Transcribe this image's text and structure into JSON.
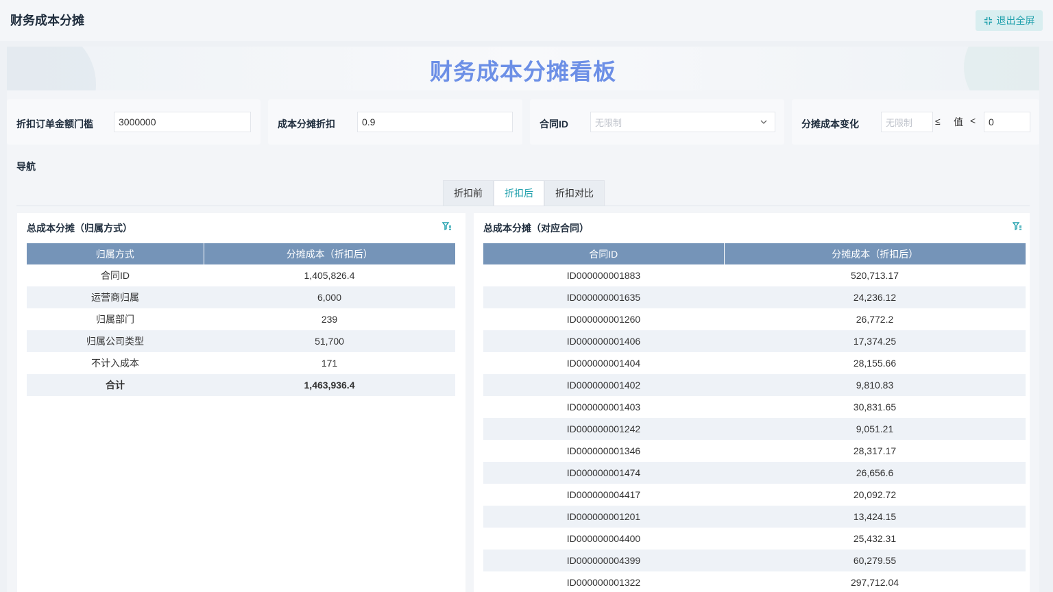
{
  "app": {
    "title": "财务成本分摊",
    "exit_label": "退出全屏"
  },
  "dashboard": {
    "title": "财务成本分摊看板"
  },
  "filters": {
    "threshold": {
      "label": "折扣订单金额门槛",
      "value": "3000000"
    },
    "discount": {
      "label": "成本分摊折扣",
      "value": "0.9"
    },
    "contract": {
      "label": "合同ID",
      "placeholder": "无限制"
    },
    "change": {
      "label": "分摊成本变化",
      "placeholder": "无限制",
      "op1": "≤",
      "mid": "值",
      "op2": "<",
      "value": "0"
    }
  },
  "nav": {
    "label": "导航",
    "tabs": [
      {
        "label": "折扣前"
      },
      {
        "label": "折扣后"
      },
      {
        "label": "折扣对比"
      }
    ]
  },
  "left_panel": {
    "title": "总成本分摊（归属方式）",
    "columns": [
      "归属方式",
      "分摊成本（折扣后）"
    ],
    "rows": [
      [
        "合同ID",
        "1,405,826.4"
      ],
      [
        "运营商归属",
        "6,000"
      ],
      [
        "归属部门",
        "239"
      ],
      [
        "归属公司类型",
        "51,700"
      ],
      [
        "不计入成本",
        "171"
      ]
    ],
    "total": [
      "合计",
      "1,463,936.4"
    ]
  },
  "right_panel": {
    "title": "总成本分摊（对应合同）",
    "columns": [
      "合同ID",
      "分摊成本（折扣后）"
    ],
    "rows": [
      [
        "ID000000001883",
        "520,713.17"
      ],
      [
        "ID000000001635",
        "24,236.12"
      ],
      [
        "ID000000001260",
        "26,772.2"
      ],
      [
        "ID000000001406",
        "17,374.25"
      ],
      [
        "ID000000001404",
        "28,155.66"
      ],
      [
        "ID000000001402",
        "9,810.83"
      ],
      [
        "ID000000001403",
        "30,831.65"
      ],
      [
        "ID000000001242",
        "9,051.21"
      ],
      [
        "ID000000001346",
        "28,317.17"
      ],
      [
        "ID000000001474",
        "26,656.6"
      ],
      [
        "ID000000004417",
        "20,092.72"
      ],
      [
        "ID000000001201",
        "13,424.15"
      ],
      [
        "ID000000004400",
        "25,432.31"
      ],
      [
        "ID000000004399",
        "60,279.55"
      ],
      [
        "ID000000001322",
        "297,712.04"
      ]
    ]
  }
}
